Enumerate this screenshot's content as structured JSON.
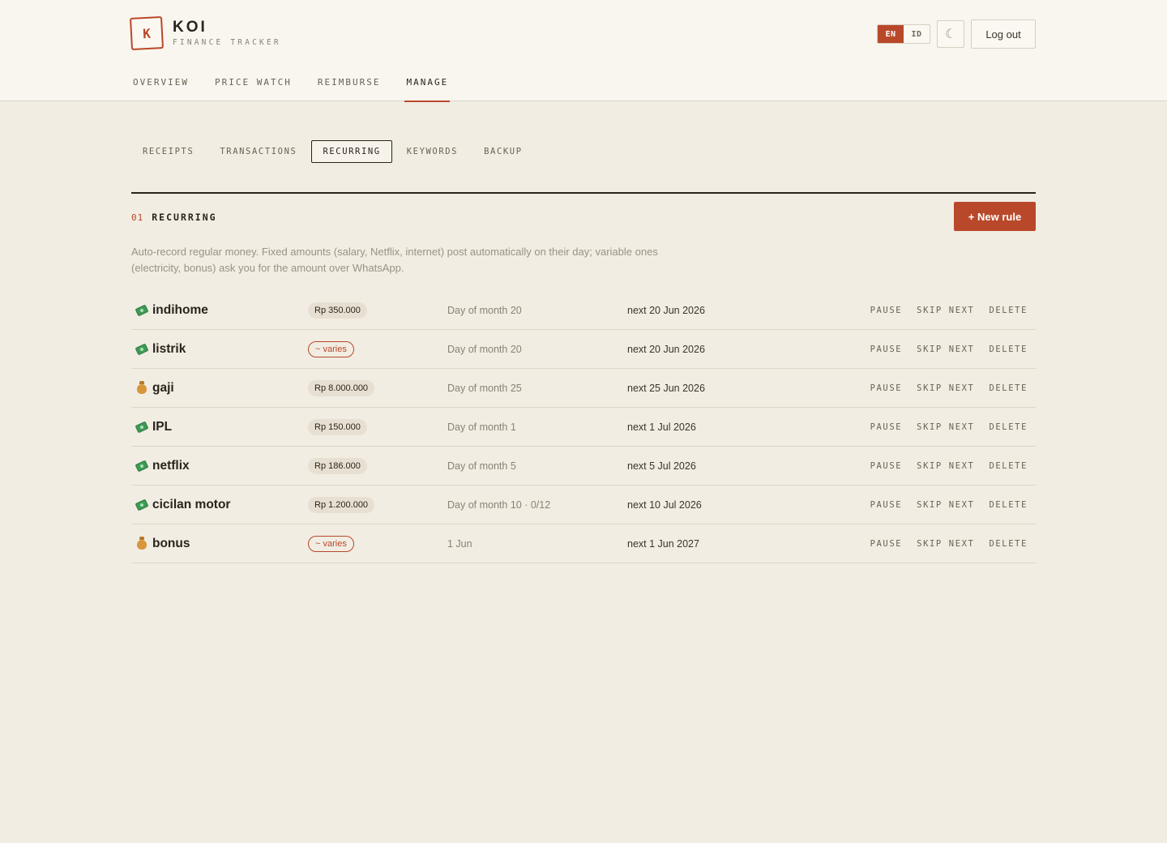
{
  "brand": {
    "logo_letter": "K",
    "name": "KOI",
    "tagline": "FINANCE TRACKER"
  },
  "header": {
    "lang": {
      "en": "EN",
      "id": "ID",
      "selected": "EN"
    },
    "theme_icon": "☾",
    "logout_label": "Log out"
  },
  "main_nav": [
    {
      "label": "OVERVIEW",
      "active": false
    },
    {
      "label": "PRICE WATCH",
      "active": false
    },
    {
      "label": "REIMBURSE",
      "active": false
    },
    {
      "label": "MANAGE",
      "active": true
    }
  ],
  "sub_tabs": [
    {
      "label": "RECEIPTS",
      "active": false
    },
    {
      "label": "TRANSACTIONS",
      "active": false
    },
    {
      "label": "RECURRING",
      "active": true
    },
    {
      "label": "KEYWORDS",
      "active": false
    },
    {
      "label": "BACKUP",
      "active": false
    }
  ],
  "section": {
    "number": "01",
    "title": "RECURRING",
    "new_rule_label": "+ New rule",
    "description": "Auto-record regular money. Fixed amounts (salary, Netflix, internet) post automatically on their day; variable ones (electricity, bonus) ask you for the amount over WhatsApp."
  },
  "actions": {
    "pause": "PAUSE",
    "skip_next": "SKIP NEXT",
    "delete": "DELETE"
  },
  "rules": [
    {
      "icon": "money-icon",
      "name": "indihome",
      "amount": "Rp 350.000",
      "varies": false,
      "schedule": "Day of month 20",
      "next": "next 20 Jun 2026"
    },
    {
      "icon": "money-icon",
      "name": "listrik",
      "amount": "~ varies",
      "varies": true,
      "schedule": "Day of month 20",
      "next": "next 20 Jun 2026"
    },
    {
      "icon": "money-bag-icon",
      "name": "gaji",
      "amount": "Rp 8.000.000",
      "varies": false,
      "schedule": "Day of month 25",
      "next": "next 25 Jun 2026"
    },
    {
      "icon": "money-icon",
      "name": "IPL",
      "amount": "Rp 150.000",
      "varies": false,
      "schedule": "Day of month 1",
      "next": "next 1 Jul 2026"
    },
    {
      "icon": "money-icon",
      "name": "netflix",
      "amount": "Rp 186.000",
      "varies": false,
      "schedule": "Day of month 5",
      "next": "next 5 Jul 2026"
    },
    {
      "icon": "money-icon",
      "name": "cicilan motor",
      "amount": "Rp 1.200.000",
      "varies": false,
      "schedule": "Day of month 10 · 0/12",
      "next": "next 10 Jul 2026"
    },
    {
      "icon": "money-bag-icon",
      "name": "bonus",
      "amount": "~ varies",
      "varies": true,
      "schedule": "1 Jun",
      "next": "next 1 Jun 2027"
    }
  ]
}
